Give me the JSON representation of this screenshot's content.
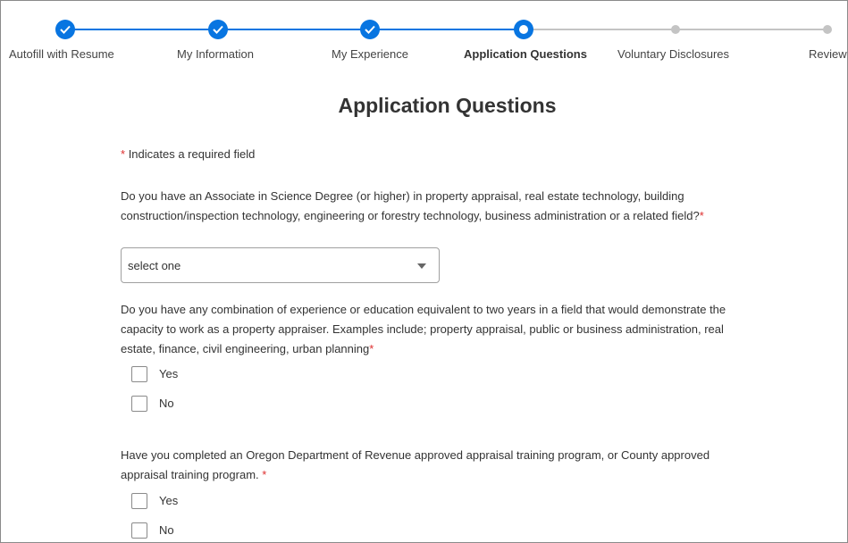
{
  "stepper": {
    "steps": [
      {
        "label": "Autofill with Resume",
        "status": "complete"
      },
      {
        "label": "My Information",
        "status": "complete"
      },
      {
        "label": "My Experience",
        "status": "complete"
      },
      {
        "label": "Application Questions",
        "status": "current"
      },
      {
        "label": "Voluntary Disclosures",
        "status": "pending"
      },
      {
        "label": "Review",
        "status": "pending"
      }
    ],
    "accent_color": "#0875e1",
    "pending_color": "#c4c4c4"
  },
  "page": {
    "title": "Application Questions",
    "required_note": "Indicates a required field",
    "required_marker": "*",
    "required_color": "#de2f2f"
  },
  "questions": [
    {
      "text": "Do you have an Associate in Science Degree (or higher) in property appraisal, real estate technology, building construction/inspection technology, engineering or forestry technology, business administration or a related field?",
      "type": "select",
      "value": "select one"
    },
    {
      "text": "Do you have any combination of experience or education equivalent to two years in a field that would demonstrate the capacity to work as a property appraiser. Examples include; property appraisal, public or business administration, real estate, finance, civil engineering, urban planning",
      "type": "checkbox",
      "options": [
        "Yes",
        "No"
      ]
    },
    {
      "text": "Have you completed an Oregon Department of Revenue approved appraisal training program, or County approved appraisal training program.",
      "type": "checkbox",
      "options": [
        "Yes",
        "No"
      ]
    }
  ]
}
